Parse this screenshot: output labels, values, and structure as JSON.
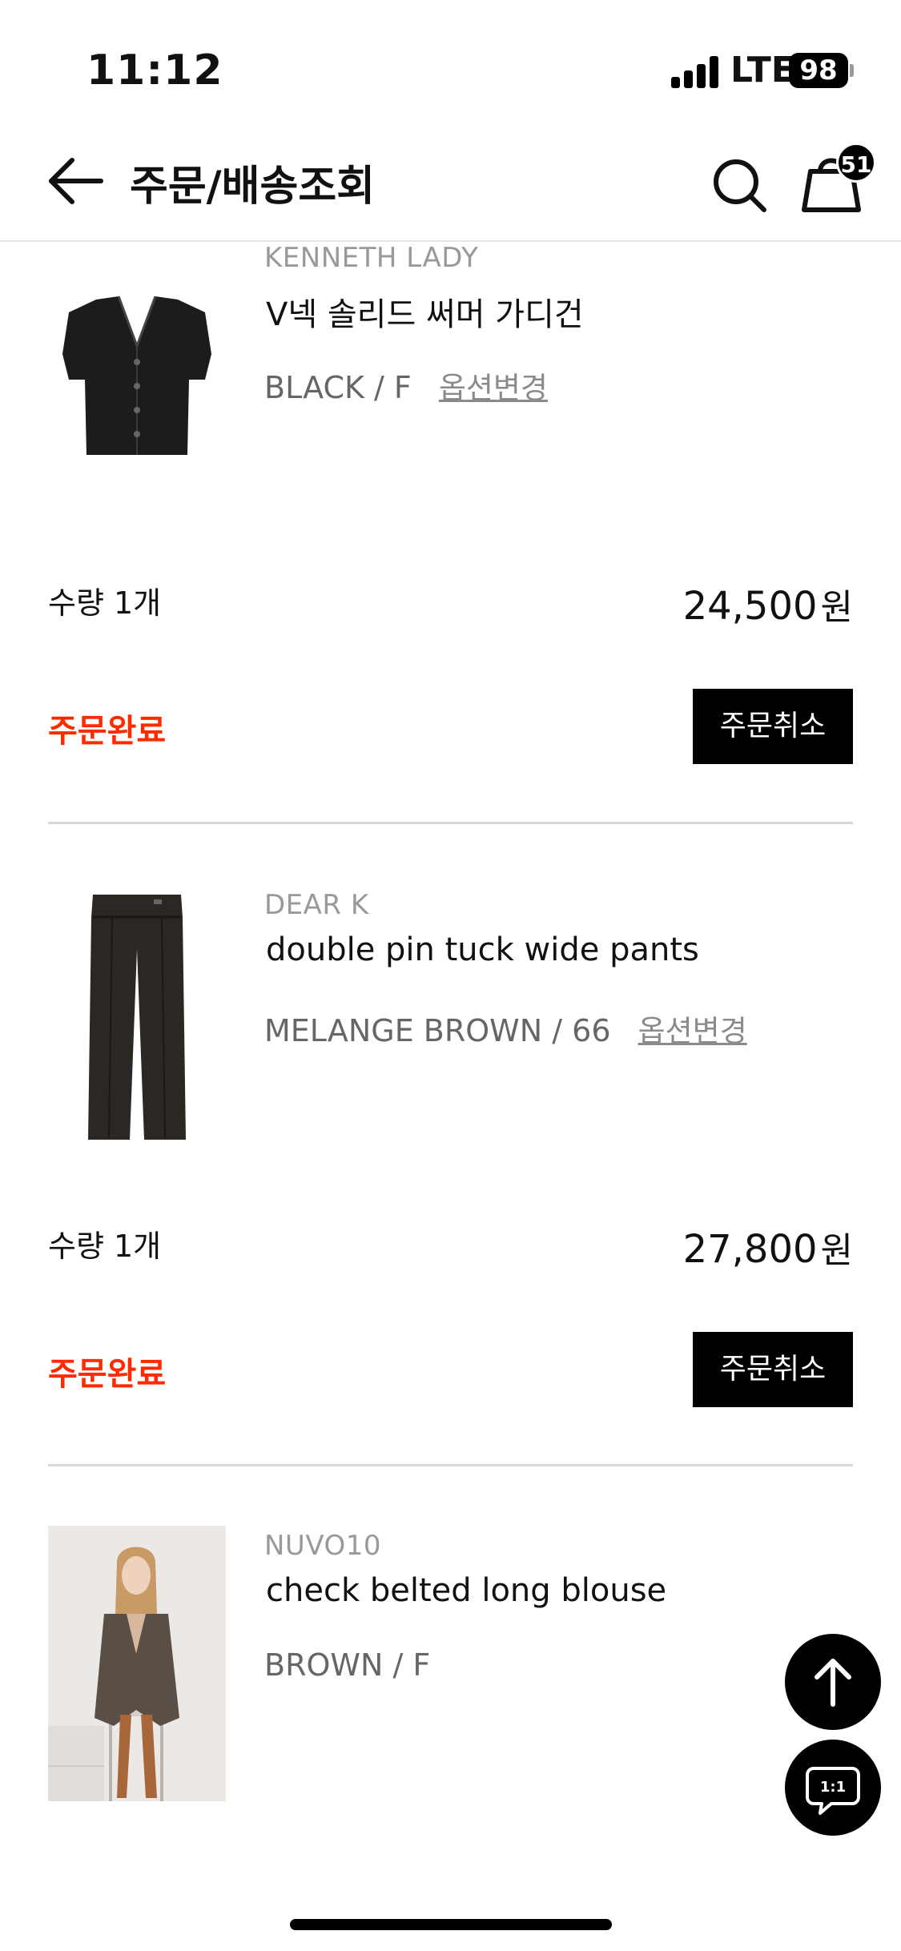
{
  "status_bar": {
    "time": "11:12",
    "network": "LTE",
    "battery": "98"
  },
  "header": {
    "title": "주문/배송조회",
    "cart_count": "51"
  },
  "orders": [
    {
      "brand": "KENNETH LADY",
      "name": "V넥 솔리드 써머 가디건",
      "option": "BLACK / F",
      "option_change": "옵션변경",
      "quantity": "수량 1개",
      "price": "24,500",
      "currency": "원",
      "status": "주문완료",
      "cancel_label": "주문취소"
    },
    {
      "brand": "DEAR K",
      "name": "double pin tuck wide pants",
      "option": "MELANGE BROWN / 66",
      "option_change": "옵션변경",
      "quantity": "수량 1개",
      "price": "27,800",
      "currency": "원",
      "status": "주문완료",
      "cancel_label": "주문취소"
    },
    {
      "brand": "NUVO10",
      "name": "check belted long blouse",
      "option": "BROWN / F"
    }
  ],
  "floating": {
    "chat_label": "1:1"
  },
  "colors": {
    "status_red": "#ff2b00",
    "button_black": "#000000",
    "muted_gray": "#999999"
  }
}
